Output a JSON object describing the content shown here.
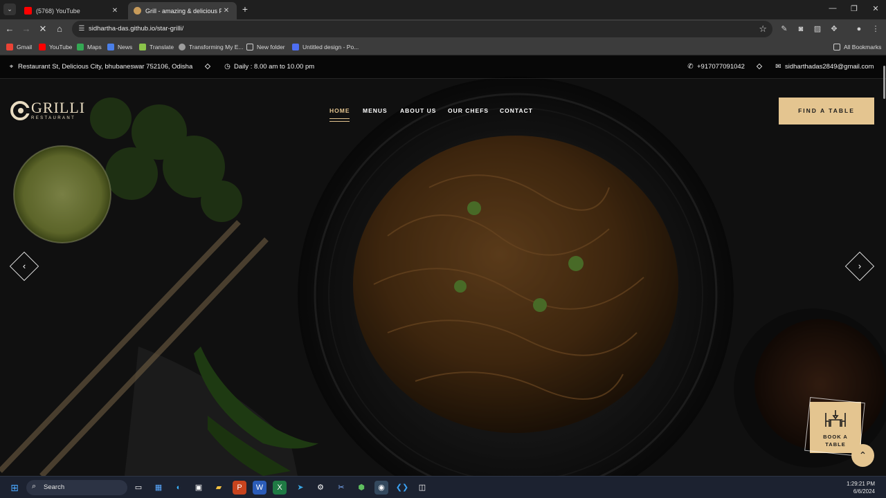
{
  "browser": {
    "tabs": [
      {
        "title": "(5768) YouTube",
        "favicon": "youtube-icon",
        "active": false
      },
      {
        "title": "Grill - amazing & delicious Foo",
        "favicon": "grilli-icon",
        "active": true
      }
    ],
    "url": "sidhartha-das.github.io/star-grilli/",
    "bookmarks": [
      "Gmail",
      "YouTube",
      "Maps",
      "News",
      "Translate",
      "Transforming My E...",
      "New folder",
      "Untitled design - Po..."
    ],
    "all_bookmarks": "All Bookmarks"
  },
  "site": {
    "topbar": {
      "address": "Restaurant St, Delicious City, bhubaneswar 752106, Odisha",
      "hours": "Daily : 8.00 am to 10.00 pm",
      "phone": "+917077091042",
      "email": "sidharthadas2849@gmail.com"
    },
    "logo": {
      "name": "GRILLI",
      "sub": "RESTAURANT"
    },
    "nav": [
      "HOME",
      "MENUS",
      "ABOUT US",
      "OUR CHEFS",
      "CONTACT"
    ],
    "active_nav": "HOME",
    "cta": "FIND A TABLE",
    "book_table": {
      "line1": "BOOK A",
      "line2": "TABLE"
    },
    "colors": {
      "accent": "#e4c590",
      "text": "#ffffff"
    }
  },
  "taskbar": {
    "search_label": "Search",
    "time": "1:29:21 PM",
    "date": "6/6/2024"
  }
}
